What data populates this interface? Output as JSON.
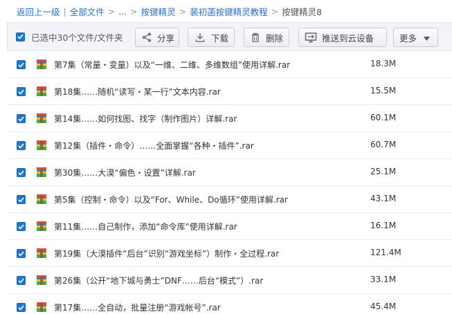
{
  "breadcrumb": {
    "back": "返回上一级",
    "divider": "|",
    "all_files": "全部文件",
    "ellipsis": "...",
    "path": [
      "按键精灵",
      "裴初菡按键精灵教程"
    ],
    "current": "按键精灵8"
  },
  "toolbar": {
    "selection_text": "已选中30个文件/文件夹",
    "share_label": "分享",
    "download_label": "下载",
    "delete_label": "删除",
    "push_label": "推送到云设备",
    "more_label": "更多"
  },
  "files": [
    {
      "name": "第7集（常量・变量）以及“一维、二维、多维数组”使用详解.rar",
      "size": "18.3M"
    },
    {
      "name": "第18集……随机“读写・某一行”文本内容.rar",
      "size": "15.5M"
    },
    {
      "name": "第14集……如何找图、找字（制作图片）详解.rar",
      "size": "60.1M"
    },
    {
      "name": "第12集（插件・命令）……全面掌握“各种・插件”.rar",
      "size": "60.7M"
    },
    {
      "name": "第30集……大漠“偏色・设置”详解.rar",
      "size": "25.1M"
    },
    {
      "name": "第5集（控制・命令）以及“For、While、Do循环”使用详解.rar",
      "size": "43.1M"
    },
    {
      "name": "第11集……自己制作，添加“命令库”使用详解.rar",
      "size": "16.1M"
    },
    {
      "name": "第19集（大漠插件“后台”识别“游戏坐标”）制作・全过程.rar",
      "size": "121.4M"
    },
    {
      "name": "第26集（公开“地下城与勇士”DNF……后台“模式”）.rar",
      "size": "33.1M"
    },
    {
      "name": "第17集……全自动，批量注册“游戏帐号”.rar",
      "size": "45.4M"
    }
  ]
}
